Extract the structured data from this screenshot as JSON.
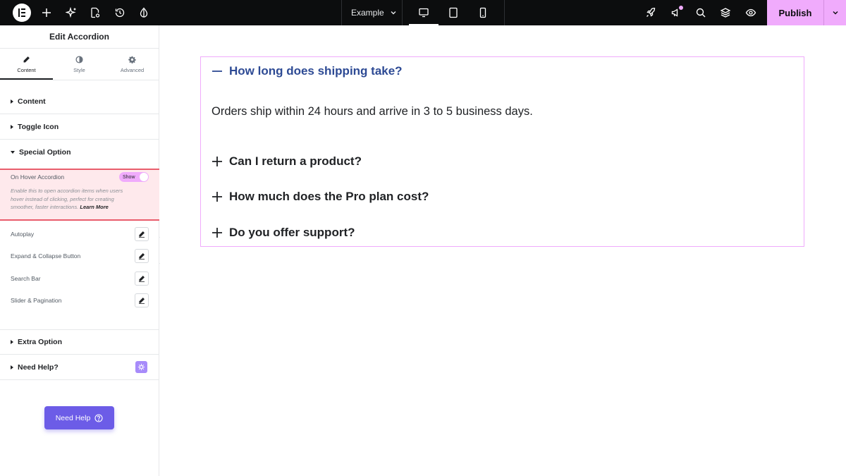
{
  "topbar": {
    "doc_title": "Example",
    "publish_label": "Publish",
    "icons": [
      "elementor-logo",
      "add-icon",
      "sparkle-icon",
      "page-settings-icon",
      "history-icon",
      "theme-icon",
      "rocket-icon",
      "announcement-icon",
      "search-icon",
      "layers-icon",
      "preview-eye-icon"
    ],
    "accent": "#f0abfc"
  },
  "panel": {
    "title": "Edit Accordion",
    "tabs": [
      {
        "label": "Content",
        "icon": "pencil-icon",
        "active": true
      },
      {
        "label": "Style",
        "icon": "half-circle-icon",
        "active": false
      },
      {
        "label": "Advanced",
        "icon": "gear-icon",
        "active": false
      }
    ],
    "sections": {
      "content": "Content",
      "toggle_icon": "Toggle Icon",
      "special_option": "Special Option",
      "extra_option": "Extra Option",
      "need_help": "Need Help?"
    },
    "hover": {
      "label": "On Hover Accordion",
      "toggle_label": "Show",
      "description": "Enable this to open accordion items when users hover instead of clicking, perfect for creating smoother, faster interactions.",
      "learn_more": "Learn More"
    },
    "controls": [
      {
        "label": "Autoplay"
      },
      {
        "label": "Expand & Collapse Button"
      },
      {
        "label": "Search Bar"
      },
      {
        "label": "Slider & Pagination"
      }
    ],
    "need_help_button": "Need Help"
  },
  "accordion": {
    "items": [
      {
        "title": "How long does shipping take?",
        "open": true
      },
      {
        "title": "Can I return a product?",
        "open": false
      },
      {
        "title": "How much does the Pro plan cost?",
        "open": false
      },
      {
        "title": "Do you offer support?",
        "open": false
      }
    ],
    "open_content": "Orders ship within 24 hours and arrive in 3 to 5 business days.",
    "active_color": "#2d4a94"
  }
}
